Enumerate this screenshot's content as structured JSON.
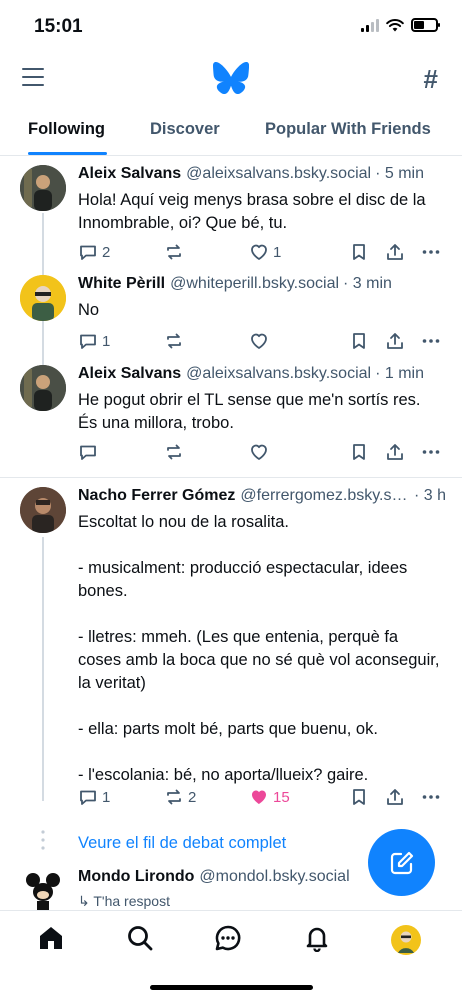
{
  "status_bar": {
    "time": "15:01"
  },
  "header": {
    "menu_icon": "hamburger-icon",
    "logo_icon": "butterfly-icon",
    "feeds_icon": "hash-icon"
  },
  "tabs": [
    {
      "label": "Following",
      "active": true
    },
    {
      "label": "Discover",
      "active": false
    },
    {
      "label": "Popular With Friends",
      "active": false
    }
  ],
  "posts": [
    {
      "author": "Aleix Salvans",
      "handle": "@aleixsalvans.bsky.social",
      "time": "· 5 min",
      "text": "Hola! Aquí veig menys brasa sobre el disc de la Innombrable, oi? Que bé, tu.",
      "replies": "2",
      "reposts": "",
      "likes": "1"
    },
    {
      "author": "White Pèrill",
      "handle": "@whiteperill.bsky.social",
      "time": "· 3 min",
      "text": "No",
      "replies": "1",
      "reposts": "",
      "likes": ""
    },
    {
      "author": "Aleix Salvans",
      "handle": "@aleixsalvans.bsky.social",
      "time": "· 1 min",
      "text": "He pogut obrir el TL sense que me'n sortís res. És una millora, trobo.",
      "replies": "",
      "reposts": "",
      "likes": ""
    },
    {
      "author": "Nacho Ferrer Gómez",
      "handle": "@ferrergomez.bsky.social",
      "time": "· 3 h",
      "text": "Escoltat lo nou de la rosalita.\n\n- musicalment: producció espectacular, idees bones.\n\n- lletres: mmeh. (Les que entenia, perquè fa coses amb la boca que no sé què vol aconseguir, la veritat)\n\n- ella: parts molt bé, parts que buenu, ok.\n\n- l'escolania: bé, no aporta/llueix? gaire.",
      "replies": "1",
      "reposts": "2",
      "likes": "15"
    }
  ],
  "thread_link": "Veure el fil de debat complet",
  "last_post": {
    "author": "Mondo Lirondo",
    "handle": "@mondol.bsky.social",
    "reply_note": "↳ T'ha respost"
  },
  "compose_icon": "compose-icon",
  "nav": [
    "home-icon",
    "search-icon",
    "chat-icon",
    "bell-icon",
    "profile-avatar"
  ],
  "colors": {
    "accent": "#1083fe",
    "like": "#ec4899",
    "muted": "#42576c"
  }
}
